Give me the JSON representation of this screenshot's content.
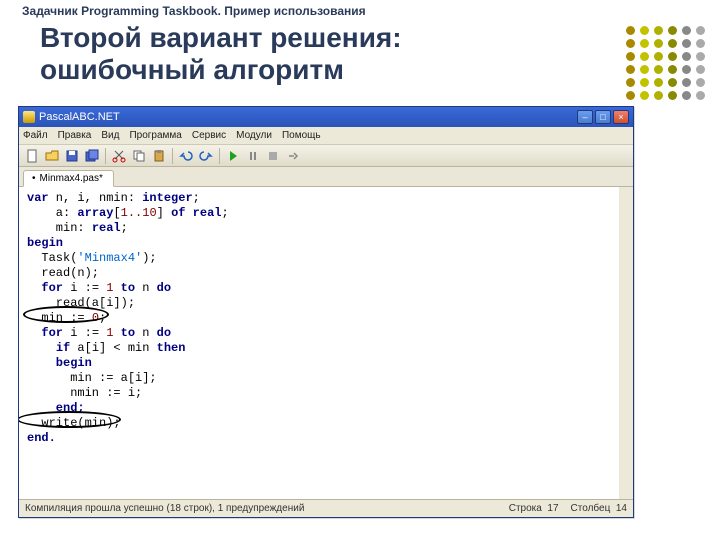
{
  "slide": {
    "header": "Задачник Programming Taskbook. Пример использования",
    "title_line1": "Второй вариант решения:",
    "title_line2": "ошибочный алгоритм"
  },
  "ide": {
    "app_title": "PascalABC.NET",
    "menu": {
      "file": "Файл",
      "edit": "Правка",
      "view": "Вид",
      "program": "Программа",
      "service": "Сервис",
      "modules": "Модули",
      "help": "Помощь"
    },
    "tab": {
      "label": "Minmax4.pas*",
      "marker": "•"
    },
    "icons": {
      "new": "new-file-icon",
      "open": "open-icon",
      "save": "save-icon",
      "saveall": "save-all-icon",
      "cut": "cut-icon",
      "copy": "copy-icon",
      "paste": "paste-icon",
      "undo": "undo-icon",
      "redo": "redo-icon",
      "run": "run-icon",
      "pause": "pause-icon",
      "stop": "stop-icon",
      "step": "step-icon"
    },
    "code": {
      "l1a": "var",
      "l1b": " n, i, nmin: ",
      "l1c": "integer",
      "l1d": ";",
      "l2a": "    a: ",
      "l2b": "array",
      "l2c": "[",
      "l2d": "1..10",
      "l2e": "] ",
      "l2f": "of",
      "l2g": " ",
      "l2h": "real",
      "l2i": ";",
      "l3a": "    min: ",
      "l3b": "real",
      "l3c": ";",
      "l4": "begin",
      "l5a": "  Task(",
      "l5b": "'Minmax4'",
      "l5c": ");",
      "l6": "  read(n);",
      "l7a": "  ",
      "l7b": "for",
      "l7c": " i := ",
      "l7d": "1",
      "l7e": " ",
      "l7f": "to",
      "l7g": " n ",
      "l7h": "do",
      "l8": "    read(a[i]);",
      "l9a": "  min := ",
      "l9b": "0",
      "l9c": ";",
      "l10a": "  ",
      "l10b": "for",
      "l10c": " i := ",
      "l10d": "1",
      "l10e": " ",
      "l10f": "to",
      "l10g": " n ",
      "l10h": "do",
      "l11a": "    ",
      "l11b": "if",
      "l11c": " a[i] < min ",
      "l11d": "then",
      "l12": "    begin",
      "l13": "      min := a[i];",
      "l14": "      nmin := i;",
      "l15": "    end;",
      "l16": "  write(min);",
      "l17": "end."
    },
    "status": {
      "compile": "Компиляция прошла успешно (18 строк), 1 предупреждений",
      "ln_label": "Строка",
      "ln_val": "17",
      "col_label": "Столбец",
      "col_val": "14"
    },
    "win": {
      "min": "–",
      "max": "□",
      "close": "×"
    }
  }
}
